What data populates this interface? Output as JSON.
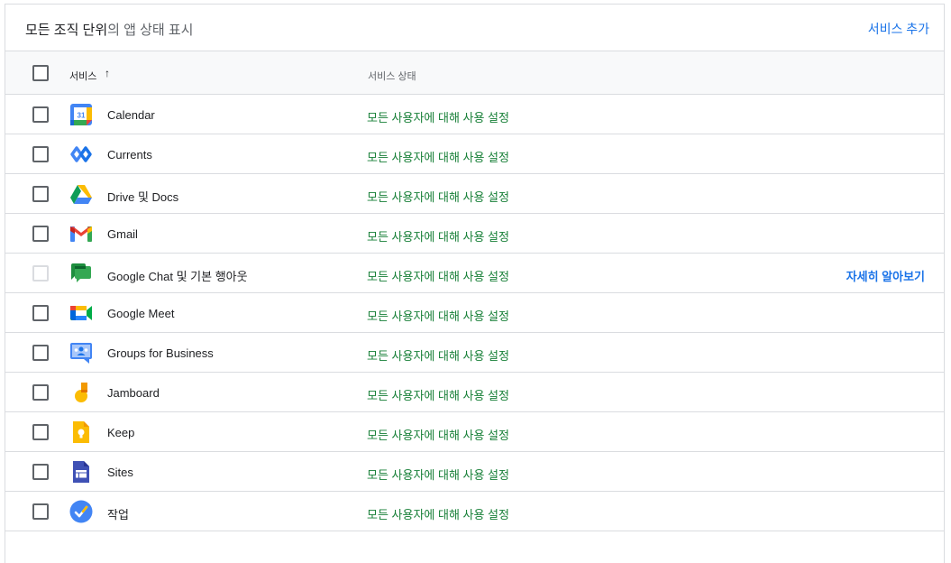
{
  "header": {
    "title_bold": "모든 조직 단위",
    "title_rest": "의 앱 상태 표시",
    "add_service": "서비스 추가"
  },
  "columns": {
    "service": "서비스",
    "sort_arrow": "↑",
    "status": "서비스 상태"
  },
  "rows": [
    {
      "name": "Calendar",
      "icon": "google-calendar-icon",
      "status": "모든 사용자에 대해 사용 설정"
    },
    {
      "name": "Currents",
      "icon": "google-currents-icon",
      "status": "모든 사용자에 대해 사용 설정"
    },
    {
      "name": "Drive 및 Docs",
      "icon": "google-drive-icon",
      "status": "모든 사용자에 대해 사용 설정"
    },
    {
      "name": "Gmail",
      "icon": "gmail-icon",
      "status": "모든 사용자에 대해 사용 설정"
    },
    {
      "name": "Google Chat 및 기본 행아웃",
      "icon": "google-chat-icon",
      "status": "모든 사용자에 대해 사용 설정",
      "link": "자세히 알아보기",
      "checkbox_disabled": true
    },
    {
      "name": "Google Meet",
      "icon": "google-meet-icon",
      "status": "모든 사용자에 대해 사용 설정"
    },
    {
      "name": "Groups for Business",
      "icon": "google-groups-icon",
      "status": "모든 사용자에 대해 사용 설정"
    },
    {
      "name": "Jamboard",
      "icon": "jamboard-icon",
      "status": "모든 사용자에 대해 사용 설정"
    },
    {
      "name": "Keep",
      "icon": "google-keep-icon",
      "status": "모든 사용자에 대해 사용 설정"
    },
    {
      "name": "Sites",
      "icon": "google-sites-icon",
      "status": "모든 사용자에 대해 사용 설정"
    },
    {
      "name": "작업",
      "icon": "google-tasks-icon",
      "status": "모든 사용자에 대해 사용 설정"
    }
  ],
  "colors": {
    "link": "#1a73e8",
    "status_on": "#188038",
    "border": "#dadce0"
  }
}
